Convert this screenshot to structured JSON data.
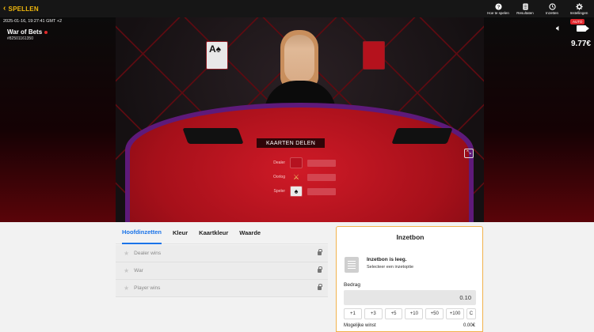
{
  "topbar": {
    "back_label": "SPELLEN",
    "actions": [
      {
        "label": "Hoe te spelen",
        "icon": "help-icon"
      },
      {
        "label": "Resultaten",
        "icon": "results-icon"
      },
      {
        "label": "Inzetten",
        "icon": "history-icon"
      },
      {
        "label": "Instellingen",
        "icon": "gear-icon"
      }
    ]
  },
  "game": {
    "datetime": "2025-01-16, 19:27:41 GMT +2",
    "title": "War of Bets",
    "round_id": "#82501161350",
    "status_label": "KAARTEN DELEN",
    "rows": [
      {
        "label": "Dealer"
      },
      {
        "label": "Oorlog"
      },
      {
        "label": "Speler"
      }
    ],
    "auto_badge": "AUTO",
    "balance": "9.77€"
  },
  "tabs": [
    {
      "label": "Hoofdinzetten",
      "active": true
    },
    {
      "label": "Kleur",
      "active": false
    },
    {
      "label": "Kaartkleur",
      "active": false
    },
    {
      "label": "Waarde",
      "active": false
    }
  ],
  "bets": [
    {
      "label": "Dealer wins"
    },
    {
      "label": "War"
    },
    {
      "label": "Player wins"
    }
  ],
  "slip": {
    "title": "Inzetbon",
    "empty_title": "Inzetbon is leeg.",
    "empty_sub": "Selecteer een inzetoptie",
    "amount_label": "Bedrag",
    "amount_value": "0.10",
    "quick": [
      "+1",
      "+3",
      "+5",
      "+10",
      "+50",
      "+100",
      "C"
    ],
    "win_label": "Mogelijke winst",
    "win_value": "0.00€"
  },
  "colors": {
    "accent": "#f2b90c",
    "active_tab": "#1a73e8",
    "felt": "#c8141f"
  }
}
